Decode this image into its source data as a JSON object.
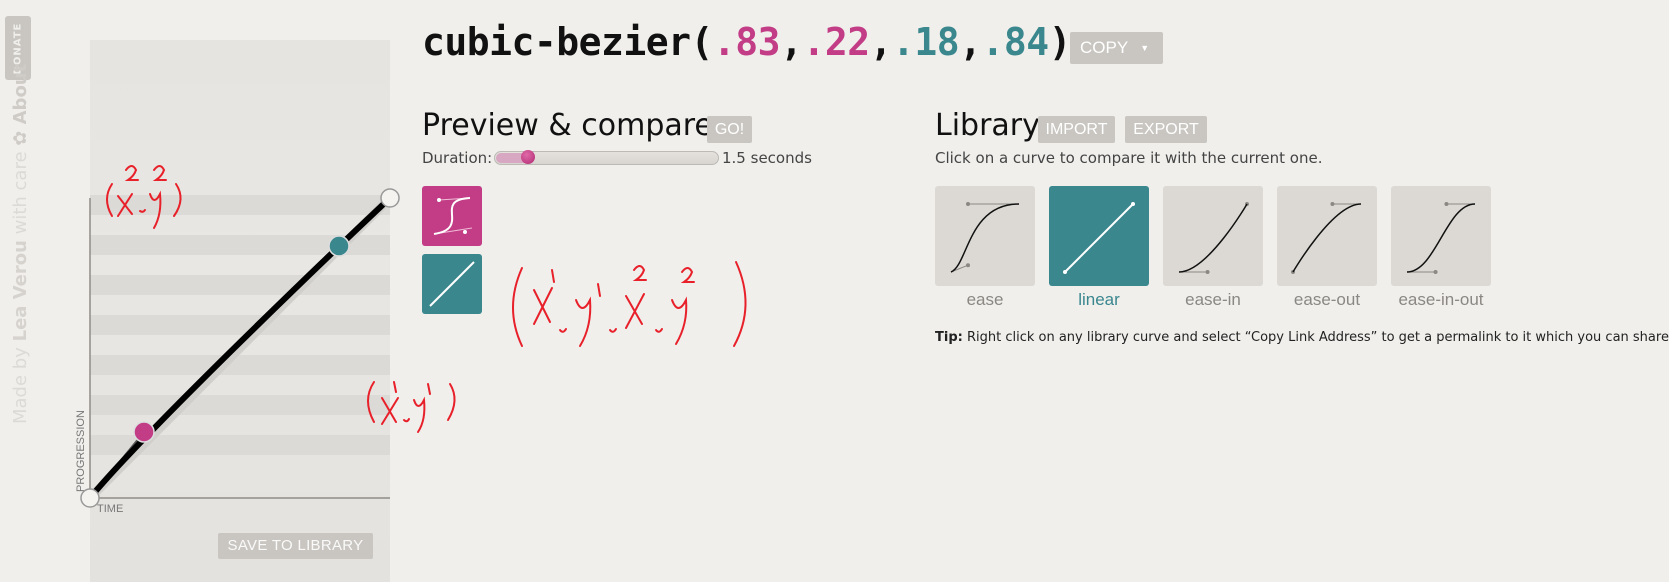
{
  "sidebar": {
    "donate_label": "DONATE",
    "credit_prefix": "Made by ",
    "credit_author": "Lea Verou",
    "credit_suffix": " with care ",
    "about_label": "About"
  },
  "header": {
    "fn_name": "cubic-bezier(",
    "p1": ".83",
    "p2": ".22",
    "p3": ".18",
    "p4": ".84",
    "comma": ",",
    "close": ")",
    "copy_label": "COPY",
    "copy_caret": "▼"
  },
  "graph": {
    "progression_label": "PROGRESSION",
    "time_label": "TIME",
    "save_label": "SAVE TO LIBRARY",
    "bezier": [
      0.18,
      0.84,
      0.83,
      0.22
    ]
  },
  "preview": {
    "title": "Preview & compare",
    "go_label": "GO!",
    "duration_label": "Duration:",
    "duration_value": 1.5,
    "duration_text": "1.5 seconds"
  },
  "library": {
    "title": "Library",
    "import_label": "IMPORT",
    "export_label": "EXPORT",
    "description": "Click on a curve to compare it with the current one.",
    "items": [
      {
        "label": "ease",
        "curve": [
          0.25,
          0.1,
          0.25,
          1
        ],
        "active": false
      },
      {
        "label": "linear",
        "curve": [
          0,
          0,
          1,
          1
        ],
        "active": true
      },
      {
        "label": "ease-in",
        "curve": [
          0.42,
          0,
          1,
          1
        ],
        "active": false
      },
      {
        "label": "ease-out",
        "curve": [
          0,
          0,
          0.58,
          1
        ],
        "active": false
      },
      {
        "label": "ease-in-out",
        "curve": [
          0.42,
          0,
          0.58,
          1
        ],
        "active": false
      }
    ],
    "tip_bold": "Tip:",
    "tip_text": " Right click on any library curve and select “Copy Link Address” to get a permalink to it which you can share with others"
  },
  "colors": {
    "pink": "#c23c86",
    "teal": "#3a878e",
    "annotation_red": "#e8202a",
    "button_gray": "#c9c6c1"
  },
  "annotations": {
    "near_teal_handle": "(x2,y2)",
    "near_pink_handle": "(x1,y1)",
    "near_previews": "(x1,y1,x2,y2)"
  }
}
